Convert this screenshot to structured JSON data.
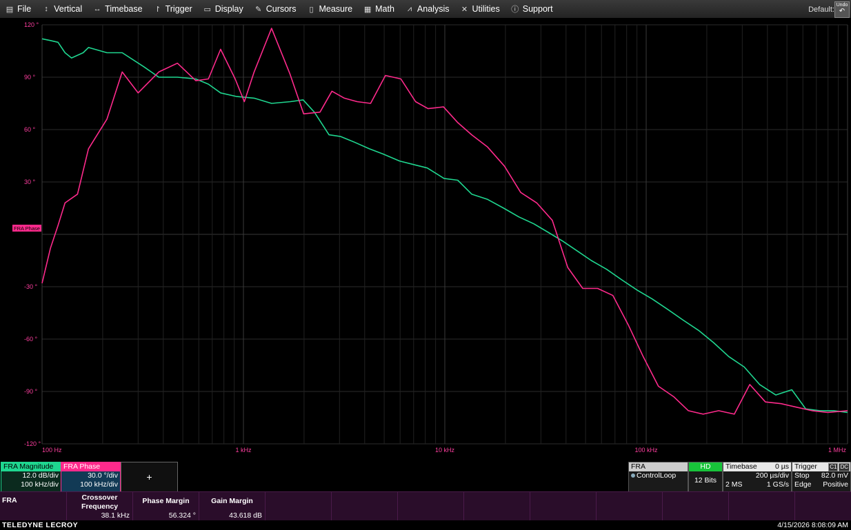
{
  "menu": [
    {
      "label": "File",
      "icon": "file-icon",
      "glyph": "▤"
    },
    {
      "label": "Vertical",
      "icon": "vertical-icon",
      "glyph": "↕"
    },
    {
      "label": "Timebase",
      "icon": "timebase-icon",
      "glyph": "↔"
    },
    {
      "label": "Trigger",
      "icon": "trigger-icon",
      "glyph": "↾"
    },
    {
      "label": "Display",
      "icon": "display-icon",
      "glyph": "▭"
    },
    {
      "label": "Cursors",
      "icon": "cursors-icon",
      "glyph": "✎"
    },
    {
      "label": "Measure",
      "icon": "measure-icon",
      "glyph": "▯"
    },
    {
      "label": "Math",
      "icon": "math-icon",
      "glyph": "▦"
    },
    {
      "label": "Analysis",
      "icon": "analysis-icon",
      "glyph": "⩘"
    },
    {
      "label": "Utilities",
      "icon": "utilities-icon",
      "glyph": "✕"
    },
    {
      "label": "Support",
      "icon": "support-icon",
      "glyph": "ⓘ"
    }
  ],
  "setup": {
    "label": "Default:",
    "undo_label": "Undo",
    "undo_glyph": "↶"
  },
  "chart_data": {
    "type": "line",
    "x_scale": "log",
    "xlim": [
      100,
      1000000
    ],
    "ylim": [
      -120,
      120
    ],
    "y_ticks": [
      "120 °",
      "90 °",
      "60 °",
      "30 °",
      "-30 °",
      "-60 °",
      "-90 °",
      "-120 °"
    ],
    "x_ticks": [
      "100 Hz",
      "1 kHz",
      "10 kHz",
      "100 kHz",
      "1 MHz"
    ],
    "grid": true,
    "colors": {
      "magnitude": "#1fd790",
      "phase": "#ff2a8c"
    },
    "trace_marker_label": "FRA Phase",
    "series": [
      {
        "name": "FRA Magnitude",
        "color": "#1fd790",
        "x": [
          100,
          110,
          120,
          130,
          140,
          160,
          170,
          210,
          230,
          250,
          320,
          380,
          470,
          580,
          670,
          770,
          920,
          1130,
          1380,
          1710,
          1980,
          2250,
          2660,
          3040,
          3520,
          4220,
          4940,
          5960,
          6980,
          8180,
          9910,
          11600,
          13600,
          16300,
          19600,
          23300,
          27700,
          32800,
          38600,
          46100,
          53400,
          63600,
          75500,
          90300,
          107000,
          128000,
          152000,
          182000,
          216000,
          257000,
          307000,
          366000,
          440000,
          529000,
          620000,
          729000,
          855000,
          1000000
        ],
        "y": [
          112,
          111,
          110,
          104,
          101,
          104,
          107,
          104,
          104,
          104,
          96,
          90,
          90,
          89,
          86,
          81,
          79,
          78,
          75,
          76,
          77,
          70,
          57,
          56,
          53,
          49,
          46,
          42,
          40,
          38,
          32,
          31,
          23,
          20,
          15,
          10,
          6,
          1,
          -4,
          -10,
          -15,
          -20,
          -26,
          -32,
          -37,
          -43,
          -49,
          -55,
          -62,
          -70,
          -76,
          -86,
          -92,
          -89,
          -100,
          -101,
          -101,
          -102
        ]
      },
      {
        "name": "FRA Phase",
        "color": "#ff2a8c",
        "x": [
          100,
          110,
          120,
          130,
          150,
          170,
          210,
          250,
          300,
          380,
          470,
          580,
          670,
          770,
          910,
          1010,
          1130,
          1380,
          1700,
          1990,
          2400,
          2750,
          3170,
          3670,
          4280,
          5070,
          6050,
          7160,
          8250,
          9850,
          11600,
          13600,
          16300,
          19800,
          23800,
          28600,
          34200,
          40800,
          48400,
          57400,
          68300,
          81600,
          96600,
          115000,
          137000,
          162000,
          192000,
          229000,
          274000,
          327000,
          391000,
          468000,
          558000,
          666000,
          797000,
          1000000
        ],
        "y": [
          -28,
          -8,
          5,
          18,
          23,
          49,
          66,
          93,
          81,
          93,
          98,
          88,
          89,
          106,
          89,
          76,
          93,
          118,
          92,
          69,
          70,
          82,
          78,
          76,
          75,
          91,
          89,
          76,
          72,
          73,
          64,
          57,
          50,
          39,
          24,
          18,
          8,
          -19,
          -31,
          -31,
          -35,
          -52,
          -70,
          -87,
          -93,
          -101,
          -103,
          -101,
          -103,
          -86,
          -96,
          -97,
          -99,
          -101,
          -102,
          -101
        ]
      }
    ]
  },
  "descriptors": {
    "magnitude": {
      "title": "FRA Magnitude",
      "vert": "12.0 dB/div",
      "horiz": "100 kHz/div"
    },
    "phase": {
      "title": "FRA Phase",
      "vert": "30.0 °/div",
      "horiz": "100 kHz/div"
    },
    "add_label": "+"
  },
  "status": {
    "fra": {
      "title": "FRA",
      "value": "ControlLoop"
    },
    "hd": {
      "title": "HD",
      "value": "12 Bits"
    },
    "timebase": {
      "title": "Timebase",
      "delay": "0 µs",
      "div": "200 µs/div",
      "samples": "2 MS",
      "rate": "1 GS/s"
    },
    "trigger": {
      "title": "Trigger",
      "channel": "C1",
      "coupling": "DC",
      "mode": "Stop",
      "level": "82.0 mV",
      "type": "Edge",
      "slope": "Positive"
    }
  },
  "results": {
    "name": "FRA",
    "columns": [
      {
        "header": "Crossover Frequency",
        "value": "38.1 kHz"
      },
      {
        "header": "Phase Margin",
        "value": "56.324 °"
      },
      {
        "header": "Gain Margin",
        "value": "43.618 dB"
      }
    ]
  },
  "footer": {
    "brand": "TELEDYNE LECROY",
    "timestamp": "4/15/2026 8:08:09 AM"
  }
}
